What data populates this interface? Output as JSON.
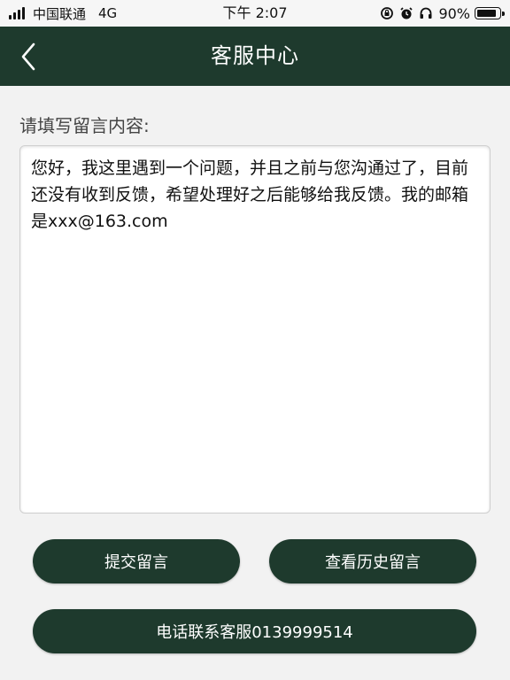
{
  "status_bar": {
    "carrier": "中国联通",
    "network": "4G",
    "time": "下午 2:07",
    "battery_percent": "90%",
    "battery_level": 0.9,
    "icons": [
      "signal-icon",
      "rotation-lock-icon",
      "alarm-icon",
      "headphones-icon",
      "battery-icon"
    ]
  },
  "nav": {
    "back_icon": "chevron-left-icon",
    "title": "客服中心"
  },
  "form": {
    "prompt_label": "请填写留言内容:",
    "message_value": "您好，我这里遇到一个问题，并且之前与您沟通过了，目前还没有收到反馈，希望处理好之后能够给我反馈。我的邮箱是xxx@163.com"
  },
  "actions": {
    "submit_label": "提交留言",
    "history_label": "查看历史留言",
    "phone_label": "电话联系客服0139999514"
  },
  "colors": {
    "primary": "#1e3a2d",
    "background": "#f2f2f2",
    "text": "#111111"
  }
}
